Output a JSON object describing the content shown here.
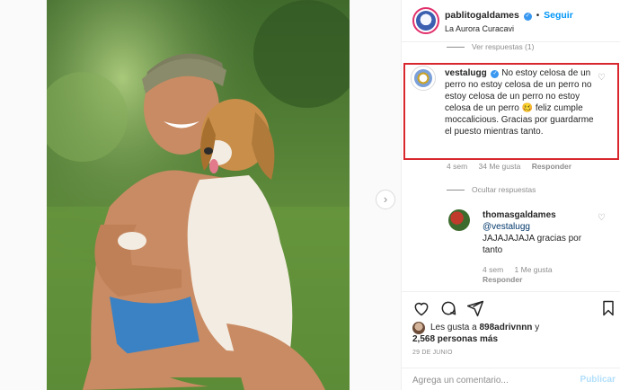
{
  "header": {
    "username": "pablitogaldames",
    "separator": "•",
    "follow_label": "Seguir",
    "location": "La Aurora Curacavi"
  },
  "comments": {
    "view_replies_top": "Ver respuestas (1)",
    "main_comment": {
      "username": "vestalugg",
      "text": "No estoy celosa de un perro no estoy celosa de un perro no estoy celosa de un perro no estoy celosa de un perro 🥴 feliz cumple moccalicious. Gracias por guardarme el puesto mientras tanto.",
      "time": "4 sem",
      "likes": "34 Me gusta",
      "reply_label": "Responder"
    },
    "hide_replies": "Ocultar respuestas",
    "reply": {
      "username": "thomasgaldames",
      "mention": "@vestalugg",
      "text": "JAJAJAJAJA gracias por tanto",
      "time": "4 sem",
      "likes": "1 Me gusta",
      "reply_label": "Responder"
    }
  },
  "actions": {
    "likes_prefix": "Les gusta a",
    "likes_user": "898adrivnnn",
    "likes_joiner": "y",
    "likes_count": "2,568 personas más",
    "date": "29 DE JUNIO"
  },
  "add_comment": {
    "placeholder": "Agrega un comentario...",
    "publish_label": "Publicar"
  },
  "icons": {
    "heart": "heart-icon",
    "comment": "comment-icon",
    "share": "share-icon",
    "save": "bookmark-icon",
    "emoji": "emoji-icon",
    "next": "chevron-right-icon"
  }
}
